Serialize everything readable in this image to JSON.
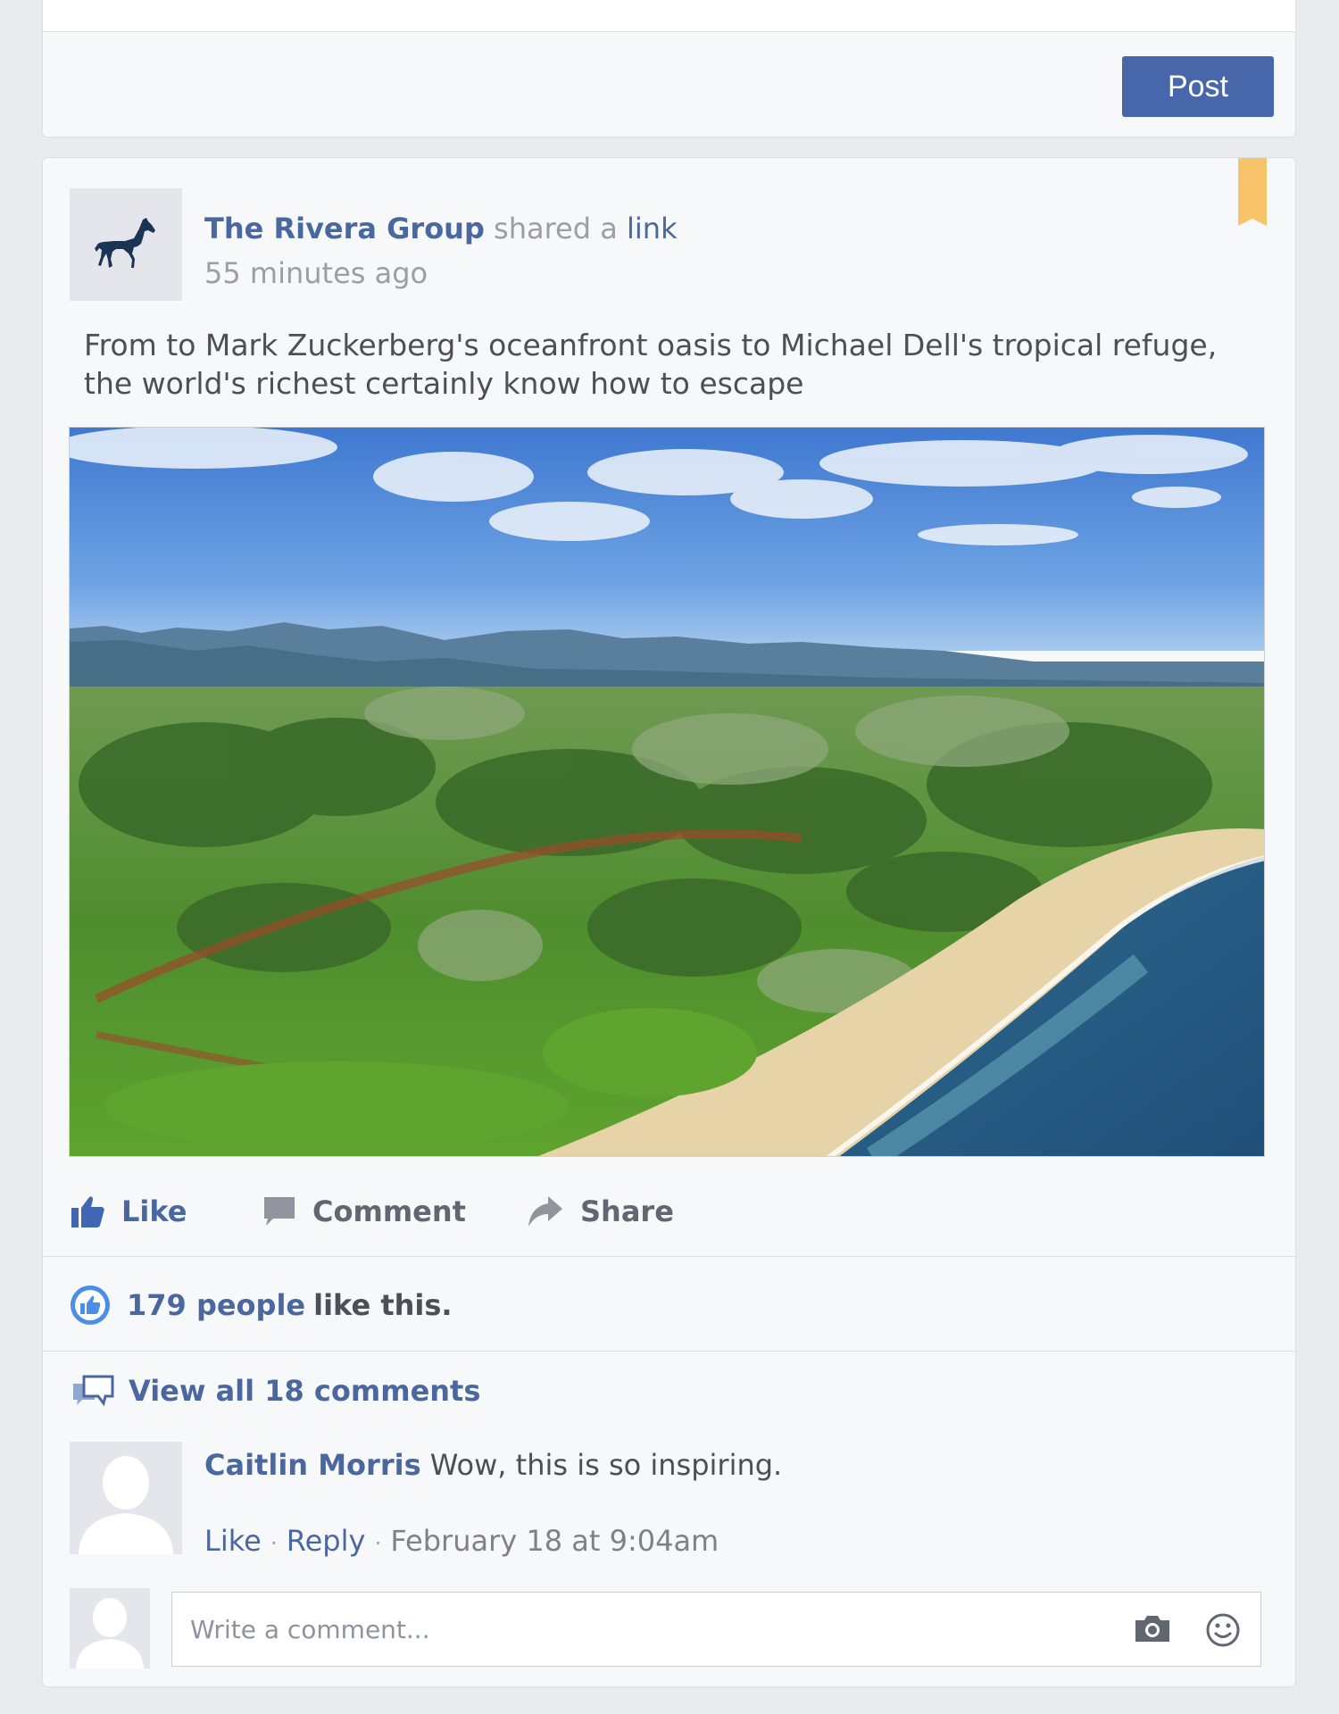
{
  "composer": {
    "post_button": "Post"
  },
  "post": {
    "author": "The Rivera Group",
    "action_text": "shared a",
    "link_text": "link",
    "timestamp": "55 minutes ago",
    "text": "From to Mark Zuckerberg's oceanfront oasis to Michael Dell's tropical refuge, the world's richest certainly know how to escape",
    "bookmark_color": "#f7c46c"
  },
  "actions": {
    "like": "Like",
    "comment": "Comment",
    "share": "Share"
  },
  "likes": {
    "count_text": "179 people",
    "rest_text": "like this."
  },
  "comments": {
    "view_all": "View all 18 comments",
    "items": [
      {
        "author": "Caitlin Morris",
        "text": "Wow, this is so inspiring.",
        "like": "Like",
        "reply": "Reply",
        "date": "February 18 at 9:04am"
      }
    ]
  },
  "comment_input": {
    "placeholder": "Write a comment..."
  },
  "icons": {
    "avatar": "horse-icon",
    "like": "thumbs-up-icon",
    "comment": "speech-bubble-icon",
    "share": "share-arrow-icon",
    "likes": "like-circle-icon",
    "view_all": "comments-icon",
    "camera": "camera-icon",
    "emoji": "smiley-icon"
  },
  "colors": {
    "brand": "#4867aa",
    "link": "#4b67a0",
    "background": "#e9ebee"
  }
}
